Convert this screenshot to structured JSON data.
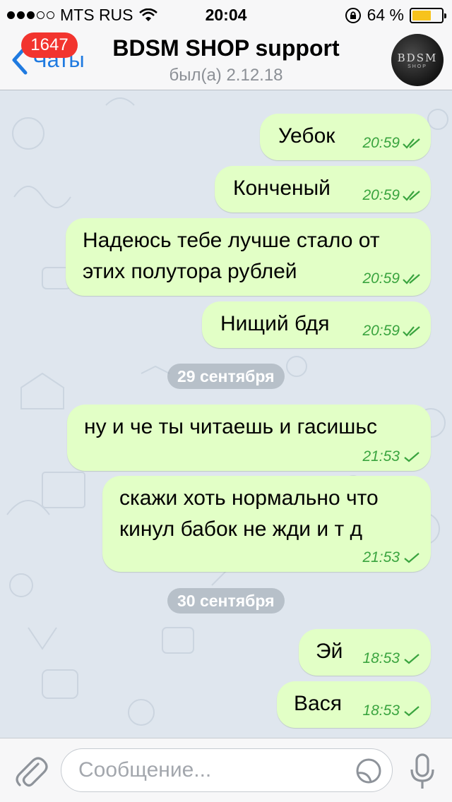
{
  "status_bar": {
    "carrier": "MTS RUS",
    "time": "20:04",
    "battery_percent": "64 %",
    "battery_level": 0.64,
    "signal_bars_filled": 3,
    "signal_bars_total": 5
  },
  "nav": {
    "back_label": "Чаты",
    "unread_badge": "1647",
    "title": "BDSM SHOP support",
    "subtitle": "был(а) 2.12.18",
    "avatar_text": "BDSM",
    "avatar_subtext": "SHOP"
  },
  "messages": [
    {
      "lines": [
        "Уебок"
      ],
      "time": "20:59",
      "status": "read"
    },
    {
      "lines": [
        "Конченый"
      ],
      "time": "20:59",
      "status": "read"
    },
    {
      "lines": [
        "Надеюсь тебе лучше стало от",
        "этих полутора рублей"
      ],
      "time": "20:59",
      "status": "read"
    },
    {
      "lines": [
        "Нищий бдя"
      ],
      "time": "20:59",
      "status": "read"
    },
    {
      "date": "29 сентября"
    },
    {
      "lines": [
        "ну и че ты читаешь и гасишьс"
      ],
      "time": "21:53",
      "status": "delivered"
    },
    {
      "lines": [
        "скажи хоть нормально что",
        "кинул бабок не жди и т д"
      ],
      "time": "21:53",
      "status": "delivered"
    },
    {
      "date": "30 сентября"
    },
    {
      "lines": [
        "Эй"
      ],
      "time": "18:53",
      "status": "delivered"
    },
    {
      "lines": [
        "Вася"
      ],
      "time": "18:53",
      "status": "delivered"
    }
  ],
  "input": {
    "placeholder": "Сообщение..."
  },
  "icons": {
    "attach": "paperclip-icon",
    "sticker": "sticker-icon",
    "mic": "microphone-icon",
    "back": "chevron-left-icon",
    "wifi": "wifi-icon",
    "lock": "rotation-lock-icon"
  },
  "colors": {
    "accent": "#1f7ae0",
    "bubble": "#e2ffc6",
    "check": "#3aa43f",
    "badge": "#f2342e",
    "battery": "#f7c31c"
  }
}
